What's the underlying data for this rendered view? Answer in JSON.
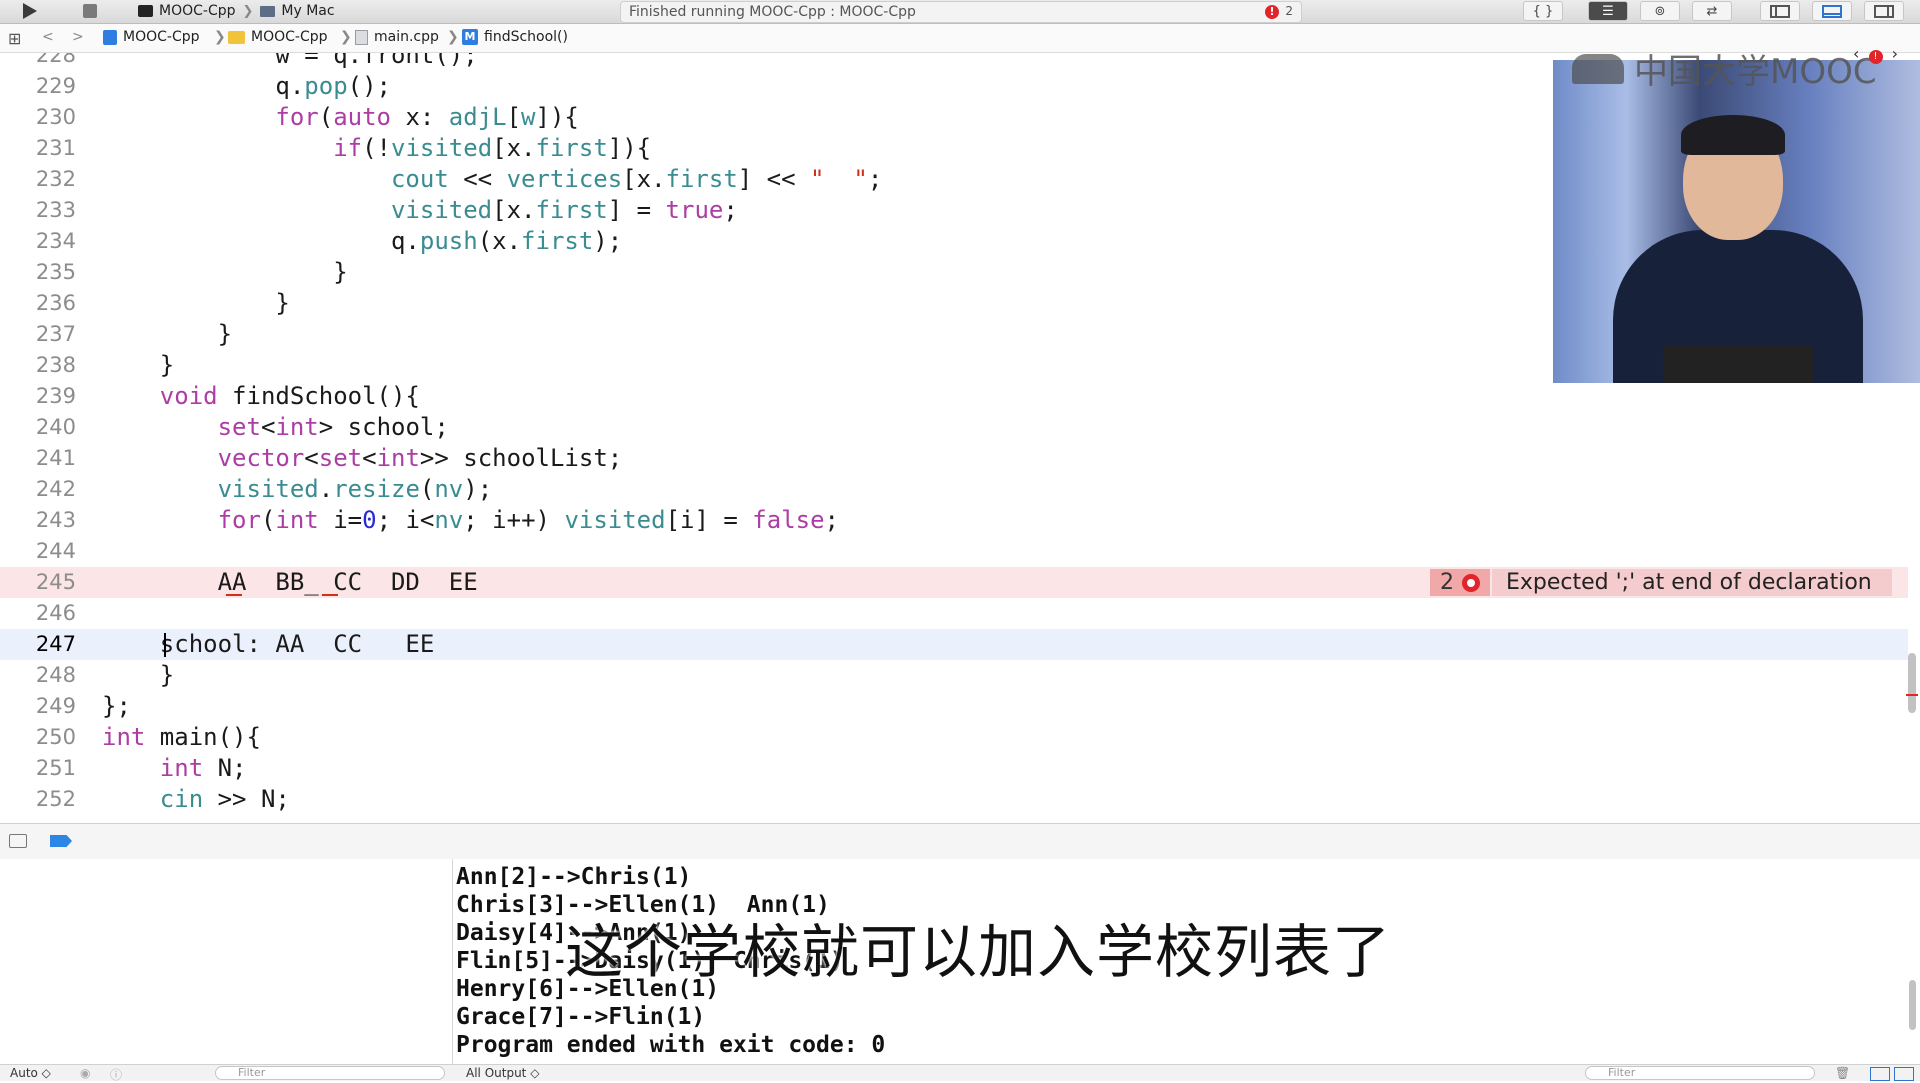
{
  "toolbar": {
    "scheme": "MOOC-Cpp",
    "destination": "My Mac",
    "status_text": "Finished running MOOC-Cpp : MOOC-Cpp",
    "status_error_count": "2",
    "error_glyph": "!",
    "right_buttons": [
      "{ }"
    ]
  },
  "jumpbar": {
    "project": "MOOC-Cpp",
    "folder": "MOOC-Cpp",
    "file": "main.cpp",
    "symbol": "findSchool()",
    "symbol_icon_letter": "M"
  },
  "editor": {
    "lines": [
      {
        "num": "228",
        "text": "            w = q.front();"
      },
      {
        "num": "229",
        "text": "            q.pop();"
      },
      {
        "num": "230",
        "text": "            for(auto x: adjL[w]){"
      },
      {
        "num": "231",
        "text": "                if(!visited[x.first]){"
      },
      {
        "num": "232",
        "text": "                    cout << vertices[x.first] << \"  \";"
      },
      {
        "num": "233",
        "text": "                    visited[x.first] = true;"
      },
      {
        "num": "234",
        "text": "                    q.push(x.first);"
      },
      {
        "num": "235",
        "text": "                }"
      },
      {
        "num": "236",
        "text": "            }"
      },
      {
        "num": "237",
        "text": "        }"
      },
      {
        "num": "238",
        "text": "    }"
      },
      {
        "num": "239",
        "text": "    void findSchool(){"
      },
      {
        "num": "240",
        "text": "        set<int> school;"
      },
      {
        "num": "241",
        "text": "        vector<set<int>> schoolList;"
      },
      {
        "num": "242",
        "text": "        visited.resize(nv);"
      },
      {
        "num": "243",
        "text": "        for(int i=0; i<nv; i++) visited[i] = false;"
      },
      {
        "num": "244",
        "text": ""
      },
      {
        "num": "245",
        "text": "        AA  BB_ CC  DD  EE"
      },
      {
        "num": "246",
        "text": ""
      },
      {
        "num": "247",
        "text": "    school: AA  CC   EE"
      },
      {
        "num": "248",
        "text": "    }"
      },
      {
        "num": "249",
        "text": "};"
      },
      {
        "num": "250",
        "text": "int main(){"
      },
      {
        "num": "251",
        "text": "    int N;"
      },
      {
        "num": "252",
        "text": "    cin >> N;"
      }
    ],
    "error_line": "245",
    "current_line": "247",
    "error_count": "2",
    "error_message": "Expected ';' at end of declaration"
  },
  "overlay": {
    "logo_text": "中国大学MOOC",
    "subtitle": "这个学校就可以加入学校列表了"
  },
  "console": {
    "lines": [
      "Ann[2]-->Chris(1)",
      "Chris[3]-->Ellen(1)  Ann(1)",
      "Daisy[4]-->Ann(1)",
      "Flin[5]-->Daisy(1)  Chris(1)",
      "Henry[6]-->Ellen(1)",
      "Grace[7]-->Flin(1)",
      "Program ended with exit code: 0"
    ]
  },
  "bottombar": {
    "left_mode": "Auto ◇",
    "left_filter_placeholder": "Filter",
    "output_mode": "All Output ◇",
    "right_filter_placeholder": "Filter"
  },
  "colors": {
    "keyword": "#ad3da4",
    "function": "#3a8c91",
    "string": "#d12f1b",
    "number": "#272ad8",
    "error": "#e0252b",
    "error_line_bg": "#fbe5e6",
    "current_line_bg": "#eaf1fd"
  }
}
